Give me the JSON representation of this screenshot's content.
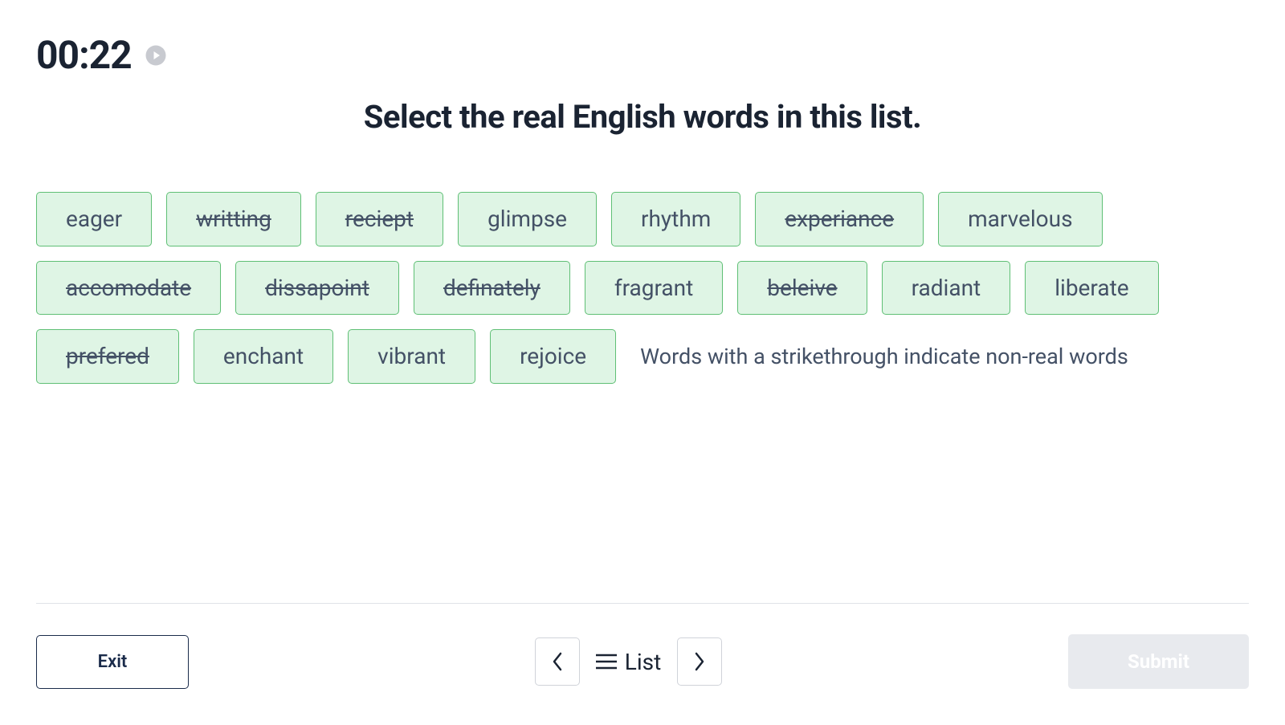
{
  "timer": "00:22",
  "question": "Select the real English words in this list.",
  "words": [
    {
      "text": "eager",
      "strike": false
    },
    {
      "text": "writting",
      "strike": true
    },
    {
      "text": "reciept",
      "strike": true
    },
    {
      "text": "glimpse",
      "strike": false
    },
    {
      "text": "rhythm",
      "strike": false
    },
    {
      "text": "experiance",
      "strike": true
    },
    {
      "text": "marvelous",
      "strike": false
    },
    {
      "text": "accomodate",
      "strike": true
    },
    {
      "text": "dissapoint",
      "strike": true
    },
    {
      "text": "definately",
      "strike": true
    },
    {
      "text": "fragrant",
      "strike": false
    },
    {
      "text": "beleive",
      "strike": true
    },
    {
      "text": "radiant",
      "strike": false
    },
    {
      "text": "liberate",
      "strike": false
    },
    {
      "text": "prefered",
      "strike": true
    },
    {
      "text": "enchant",
      "strike": false
    },
    {
      "text": "vibrant",
      "strike": false
    },
    {
      "text": "rejoice",
      "strike": false
    }
  ],
  "hint": "Words with a strikethrough indicate non-real words",
  "footer": {
    "exit": "Exit",
    "list": "List",
    "submit": "Submit"
  }
}
